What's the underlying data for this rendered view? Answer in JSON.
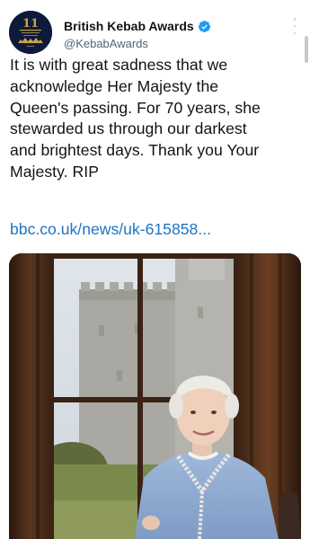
{
  "account": {
    "display_name": "British Kebab Awards",
    "handle": "@KebabAwards"
  },
  "icons": {
    "avatar": "british-kebab-awards-logo",
    "verified": "verified-badge-icon",
    "more": "more-options-icon"
  },
  "tweet": {
    "text": "It is with great sadness that we\nacknowledge Her Majesty the\nQueen's passing. For 70 years, she\nstewarded us through our darkest\nand brightest days. Thank you Your\nMajesty. RIP",
    "link": "bbc.co.uk/news/uk-615858..."
  },
  "media": {
    "subject": "Portrait of the Queen in a light blue dress by a window overlooking Windsor Castle"
  },
  "colors": {
    "link": "#1d74c4",
    "verified": "#1d9bf0",
    "handle": "#536471",
    "avatar_bg": "#0e1a3a",
    "avatar_gold": "#c9a24a"
  }
}
